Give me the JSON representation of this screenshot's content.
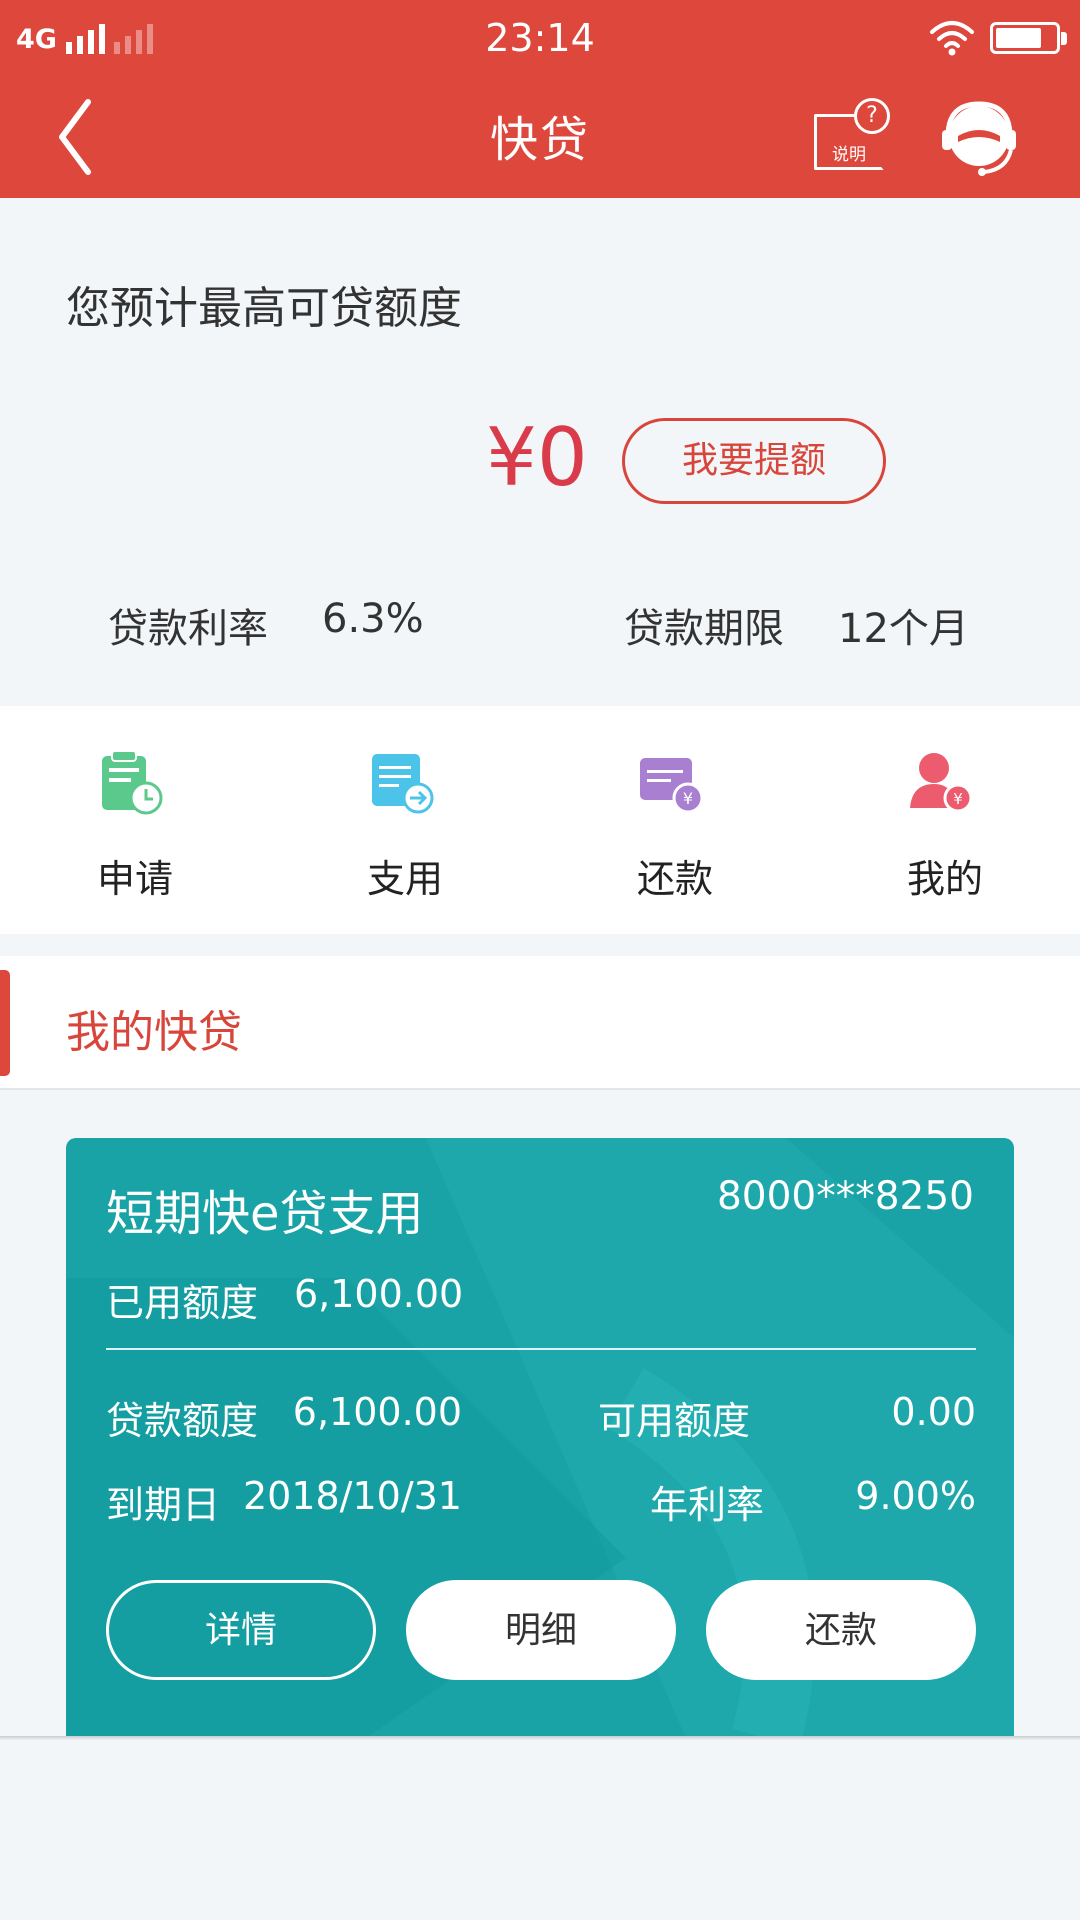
{
  "status_bar": {
    "network": "4G",
    "time": "23:14",
    "battery_level": 0.78
  },
  "header": {
    "title": "快贷",
    "help_label": "说明",
    "help_symbol": "?"
  },
  "credit": {
    "heading": "您预计最高可贷额度",
    "amount": "¥0",
    "raise_button": "我要提额",
    "rate_label": "贷款利率",
    "rate_value": "6.3%",
    "term_label": "贷款期限",
    "term_value": "12个月"
  },
  "menu": {
    "items": [
      {
        "label": "申请",
        "icon": "apply-icon",
        "color": "#5cc98c"
      },
      {
        "label": "支用",
        "icon": "withdraw-icon",
        "color": "#4cc4ea"
      },
      {
        "label": "还款",
        "icon": "repay-icon",
        "color": "#a97fd1"
      },
      {
        "label": "我的",
        "icon": "user-icon",
        "color": "#ec5b6e"
      }
    ]
  },
  "section": {
    "title": "我的快贷"
  },
  "loan_card": {
    "title": "短期快e贷支用",
    "account": "8000***8250",
    "used_label": "已用额度",
    "used_value": "6,100.00",
    "limit_label": "贷款额度",
    "limit_value": "6,100.00",
    "available_label": "可用额度",
    "available_value": "0.00",
    "due_label": "到期日",
    "due_value": "2018/10/31",
    "rate_label": "年利率",
    "rate_value": "9.00%",
    "buttons": {
      "details": "详情",
      "statement": "明细",
      "repay": "还款"
    }
  },
  "colors": {
    "brand_red": "#de473c",
    "amount_red": "#d93b4a",
    "card_teal": "#19a3a6"
  }
}
